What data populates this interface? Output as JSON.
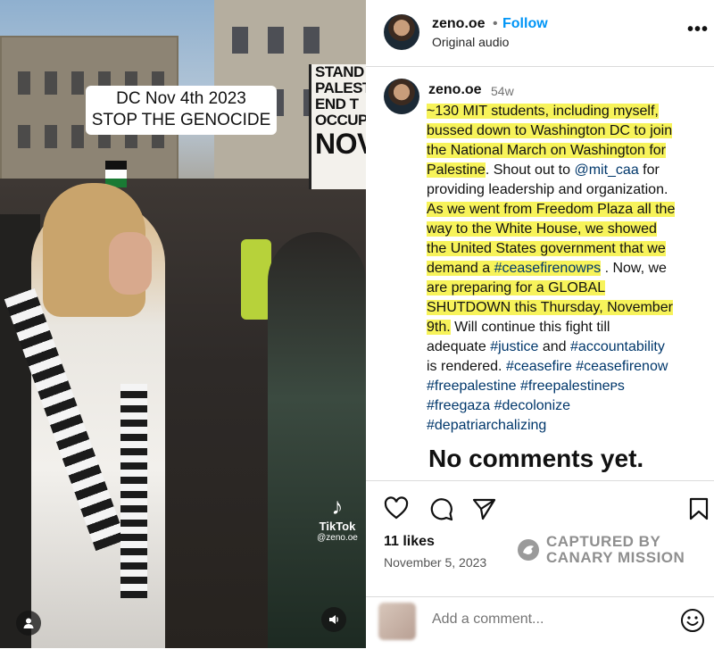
{
  "media": {
    "caption_lines": [
      "DC Nov 4th 2023",
      "STOP THE GENOCIDE"
    ],
    "banner_lines": [
      "STAND W",
      "PALESTI",
      "END T",
      "OCCUPAT",
      "NOV"
    ],
    "tiktok_logo": "♪",
    "tiktok_name": "TikTok",
    "tiktok_handle": "@zeno.oe",
    "profile_icon": "person-icon",
    "sound_icon": "speaker-icon"
  },
  "header": {
    "username": "zeno.oe",
    "separator": "•",
    "follow_label": "Follow",
    "audio": "Original audio",
    "more_label": "•••"
  },
  "caption": {
    "username": "zeno.oe",
    "time": "54w",
    "lines": [
      [
        {
          "t": "~130 MIT students, including myself,",
          "h": true
        }
      ],
      [
        {
          "t": "bussed down to Washington DC to join",
          "h": true
        }
      ],
      [
        {
          "t": "the National March on Washington for",
          "h": true
        }
      ],
      [
        {
          "t": "Palestine",
          "h": true
        },
        {
          "t": ". Shout out to "
        },
        {
          "t": "@mit_caa",
          "tag": true
        },
        {
          "t": " for"
        }
      ],
      [
        {
          "t": "providing leadership and organization."
        }
      ],
      [
        {
          "t": "As we went from Freedom Plaza all the",
          "h": true
        }
      ],
      [
        {
          "t": "way to the White House, we showed",
          "h": true
        }
      ],
      [
        {
          "t": "the United States government that we",
          "h": true
        }
      ],
      [
        {
          "t": "demand a ",
          "h": true
        },
        {
          "t": "#ceasefirenowᴘs",
          "h": true,
          "tag": true
        },
        {
          "t": " . Now, we"
        }
      ],
      [
        {
          "t": "are preparing for a GLOBAL",
          "h": true
        }
      ],
      [
        {
          "t": "SHUTDOWN this Thursday, November",
          "h": true
        }
      ],
      [
        {
          "t": "9th.",
          "h": true
        },
        {
          "t": " Will continue this fight till"
        }
      ],
      [
        {
          "t": "adequate "
        },
        {
          "t": "#justice",
          "tag": true
        },
        {
          "t": " and "
        },
        {
          "t": "#accountability",
          "tag": true
        }
      ],
      [
        {
          "t": "is rendered. "
        },
        {
          "t": "#ceasefire",
          "tag": true
        },
        {
          "t": " "
        },
        {
          "t": "#ceasefirenow",
          "tag": true
        }
      ],
      [
        {
          "t": "#freepalestine",
          "tag": true
        },
        {
          "t": " "
        },
        {
          "t": "#freepalestineᴘs",
          "tag": true
        }
      ],
      [
        {
          "t": "#freegaza",
          "tag": true
        },
        {
          "t": " "
        },
        {
          "t": "#decolonize",
          "tag": true
        }
      ],
      [
        {
          "t": "#depatriarchalizing",
          "tag": true
        }
      ]
    ],
    "no_comments": "No comments yet."
  },
  "actions": {
    "likes": "11 likes",
    "date": "November 5, 2023",
    "icons": [
      "heart-icon",
      "comment-icon",
      "share-icon",
      "bookmark-icon"
    ]
  },
  "watermark": {
    "line1": "CAPTURED BY",
    "line2": "CANARY MISSION"
  },
  "comment": {
    "placeholder": "Add a comment...",
    "emoji_icon": "smiley-icon"
  },
  "colors": {
    "highlight": "#f7f35a",
    "link": "#00376b",
    "follow": "#0095f6"
  }
}
